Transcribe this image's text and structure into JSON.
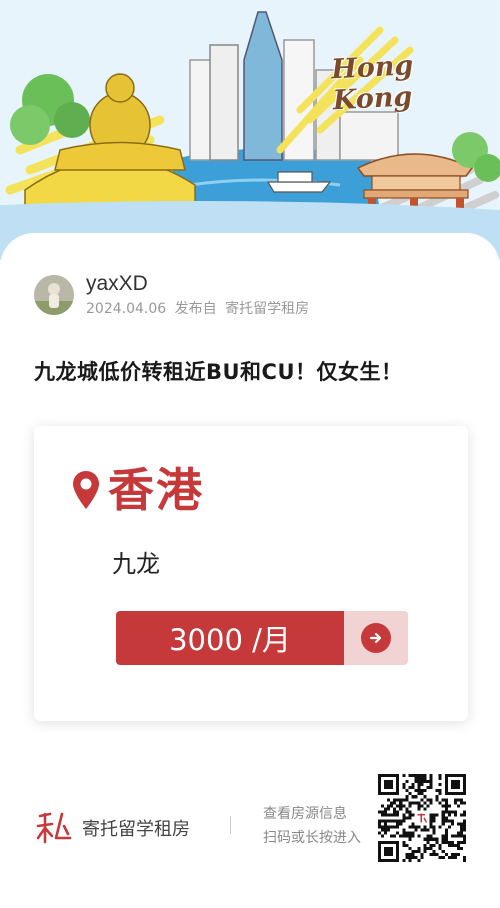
{
  "hero": {
    "banner_text": "Hong Kong",
    "icon": "hong-kong-skyline-illustration"
  },
  "author": {
    "name": "yaxXD",
    "date": "2024.04.06",
    "source_prefix": "发布自",
    "source": "寄托留学租房"
  },
  "post": {
    "title": "九龙城低价转租近BU和CU！仅女生！"
  },
  "listing": {
    "city": "香港",
    "district": "九龙",
    "price": "3000 /月",
    "accent_color": "#c6393b"
  },
  "footer": {
    "brand_name": "寄托留学租房",
    "hint_line1": "查看房源信息",
    "hint_line2": "扫码或长按进入",
    "qr_icon": "qr-code-icon"
  }
}
